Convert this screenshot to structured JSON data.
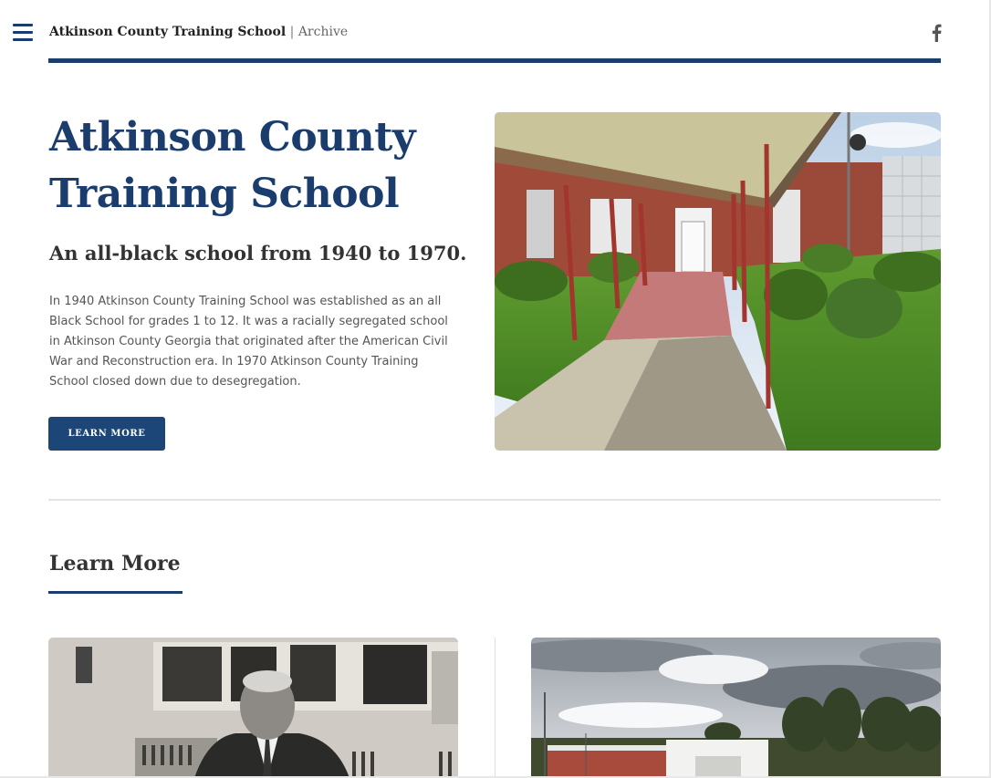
{
  "header": {
    "site_name": "Atkinson County Training School",
    "separator": " | ",
    "section": "Archive",
    "menu_icon": "hamburger-menu-icon",
    "social_icon": "facebook-icon"
  },
  "hero": {
    "title": "Atkinson County Training School",
    "subtitle": "An all-black school from 1940 to 1970.",
    "description": "In 1940 Atkinson County Training School was established as an all Black School for grades 1 to 12. It was a racially segregated school in Atkinson County Georgia that originated after the American Civil War and Reconstruction era. In 1970 Atkinson County Training School closed down due to desegregation.",
    "button_label": "LEARN MORE"
  },
  "learn_more": {
    "title": "Learn More"
  },
  "colors": {
    "brand": "#1b3d6e",
    "button": "#1b4677"
  }
}
